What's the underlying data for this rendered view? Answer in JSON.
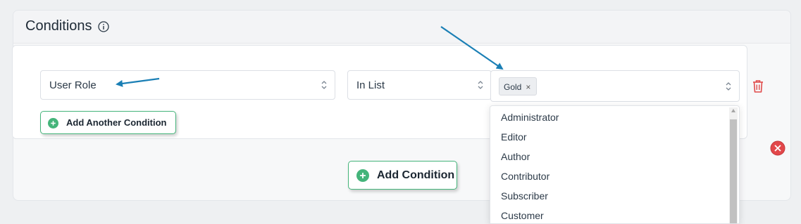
{
  "panel": {
    "title": "Conditions",
    "info_icon": "info-circle-icon"
  },
  "condition": {
    "field": {
      "value": "User Role",
      "icon": "updown-chevron-icon"
    },
    "operator": {
      "value": "In List",
      "icon": "updown-chevron-icon"
    },
    "values": {
      "tags": [
        {
          "label": "Gold",
          "remove_symbol": "×"
        }
      ],
      "icon": "updown-chevron-icon"
    },
    "delete_icon": "trash-icon"
  },
  "buttons": {
    "add_another": "Add Another Condition",
    "add_condition": "Add Condition"
  },
  "dropdown": {
    "options": [
      "Administrator",
      "Editor",
      "Author",
      "Contributor",
      "Subscriber",
      "Customer"
    ]
  },
  "colors": {
    "accent_green": "#44b47a",
    "delete_red": "#e04b4b",
    "annotation_arrow": "#1a7fb5"
  }
}
